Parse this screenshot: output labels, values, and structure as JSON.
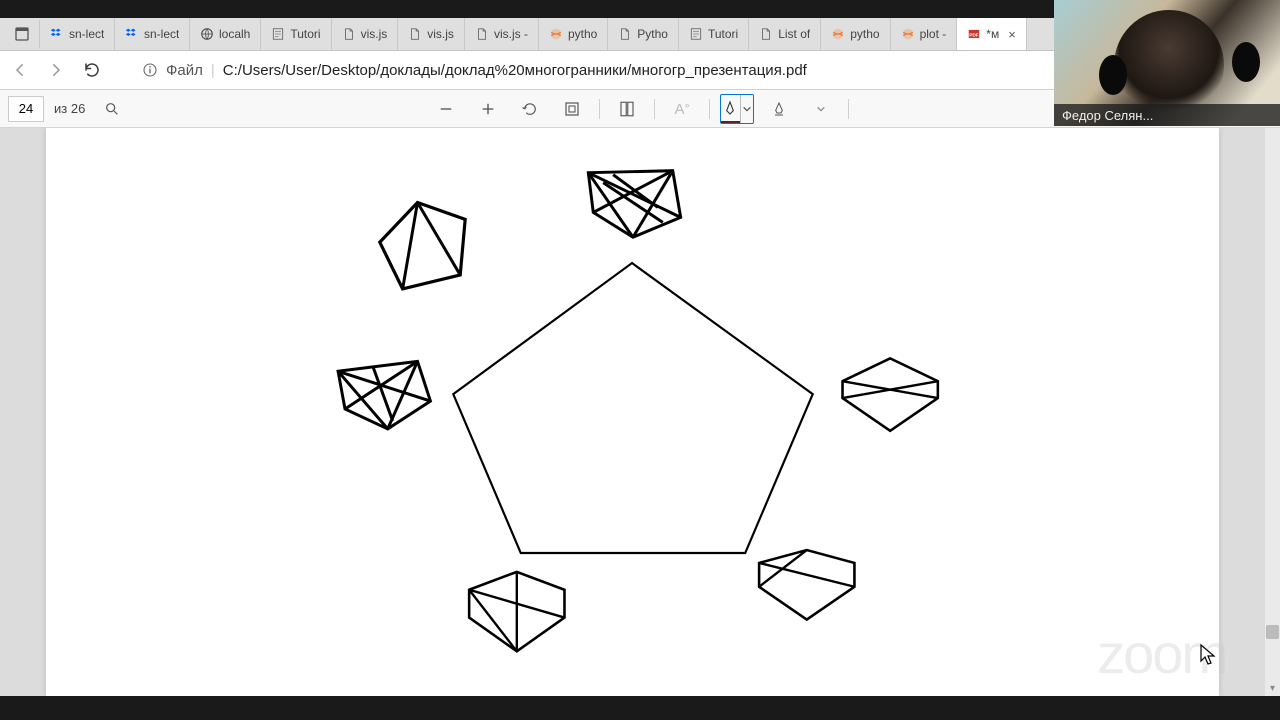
{
  "tabs": [
    {
      "label": "sn-lect",
      "icon": "dropbox"
    },
    {
      "label": "sn-lect",
      "icon": "dropbox"
    },
    {
      "label": "localh",
      "icon": "local"
    },
    {
      "label": "Tutori",
      "icon": "doc"
    },
    {
      "label": "vis.js",
      "icon": "file"
    },
    {
      "label": "vis.js",
      "icon": "file"
    },
    {
      "label": "vis.js -",
      "icon": "file"
    },
    {
      "label": "pytho",
      "icon": "jup"
    },
    {
      "label": "Pytho",
      "icon": "file"
    },
    {
      "label": "Tutori",
      "icon": "doc"
    },
    {
      "label": "List of",
      "icon": "file"
    },
    {
      "label": "pytho",
      "icon": "jup"
    },
    {
      "label": "plot -",
      "icon": "jup"
    },
    {
      "label": "*м",
      "icon": "pdf",
      "active": true
    }
  ],
  "address": {
    "proto_label": "Файл",
    "path": "C:/Users/User/Desktop/доклады/доклад%20многогранники/многогр_презентация.pdf"
  },
  "pdf": {
    "page_current": "24",
    "page_total_label": "из 26"
  },
  "participant_name": "Федор Селян...",
  "watermark": "zoom"
}
